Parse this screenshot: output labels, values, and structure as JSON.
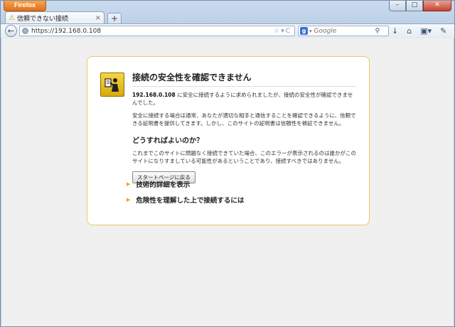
{
  "window": {
    "app_button": "Firefox",
    "minimize": "–",
    "maximize": "□",
    "close": "✕"
  },
  "tab": {
    "title": "信頼できない接続",
    "close": "×",
    "new_tab": "+"
  },
  "nav": {
    "back": "←",
    "url": "https://192.168.0.108",
    "url_icons": "☆▾C",
    "search_placeholder": "Google",
    "search_engine": "g",
    "toolbar": [
      "↓",
      "⌂",
      "▣▾",
      "✎"
    ]
  },
  "error": {
    "title": "接続の安全性を確認できません",
    "host": "192.168.0.108",
    "p1_rest": " に安全に接続するように求められましたが、接続の安全性が確認できませんでした。",
    "p2": "安全に接続する場合は通常、あなたが適切な相手と通信することを確認できるように、信頼できる証明書を提供してきます。しかし、このサイトの証明書は信頼性を検証できません。",
    "h2": "どうすればよいのか？",
    "p3": "これまでこのサイトに問題なく接続できていた場合、このエラーが表示されるのは誰かがこのサイトになりすましている可能性があるということであり、接続すべきではありません。",
    "start_button": "スタートページに戻る",
    "details": "技術的詳細を表示",
    "understand": "危険性を理解した上で接続するには"
  },
  "colors": {
    "accent": "#e2701a",
    "box_border": "#f0c46a",
    "expander_arrow": "#f0a020"
  }
}
